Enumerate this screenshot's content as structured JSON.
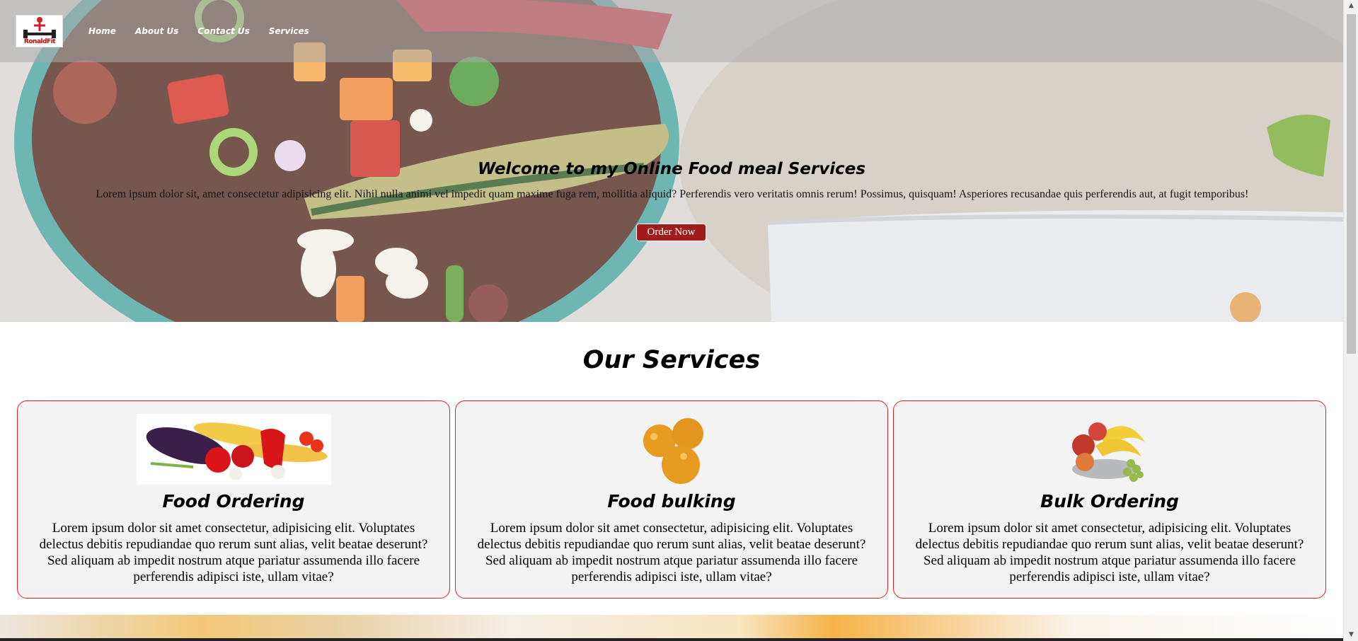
{
  "nav": {
    "logo_text": "RonaldFit",
    "links": [
      {
        "label": "Home"
      },
      {
        "label": "About Us"
      },
      {
        "label": "Contact Us"
      },
      {
        "label": "Services"
      }
    ]
  },
  "hero": {
    "title": "Welcome to my Online Food meal Services",
    "text": "Lorem ipsum dolor sit, amet consectetur adipisicing elit. Nihil nulla animi vel impedit quam maxime fuga rem, mollitia aliquid? Perferendis vero veritatis omnis rerum! Possimus, quisquam! Asperiores recusandae quis perferendis aut, at fugit temporibus!",
    "button_label": "Order Now"
  },
  "services": {
    "title": "Our Services",
    "cards": [
      {
        "title": "Food Ordering",
        "image": "vegetables-image",
        "description": "Lorem ipsum dolor sit amet consectetur, adipisicing elit. Voluptates delectus debitis repudiandae quo rerum sunt alias, velit beatae deserunt? Sed aliquam ab impedit nostrum atque pariatur assumenda illo facere perferendis adipisci iste, ullam vitae?"
      },
      {
        "title": "Food bulking",
        "image": "oranges-image",
        "description": "Lorem ipsum dolor sit amet consectetur, adipisicing elit. Voluptates delectus debitis repudiandae quo rerum sunt alias, velit beatae deserunt? Sed aliquam ab impedit nostrum atque pariatur assumenda illo facere perferendis adipisci iste, ullam vitae?"
      },
      {
        "title": "Bulk Ordering",
        "image": "fruit-basket-image",
        "description": "Lorem ipsum dolor sit amet consectetur, adipisicing elit. Voluptates delectus debitis repudiandae quo rerum sunt alias, velit beatae deserunt? Sed aliquam ab impedit nostrum atque pariatur assumenda illo facere perferendis adipisci iste, ullam vitae?"
      }
    ]
  },
  "colors": {
    "accent": "#a01c1c",
    "card_border": "#d9232a",
    "card_bg": "#f3f3f3"
  }
}
